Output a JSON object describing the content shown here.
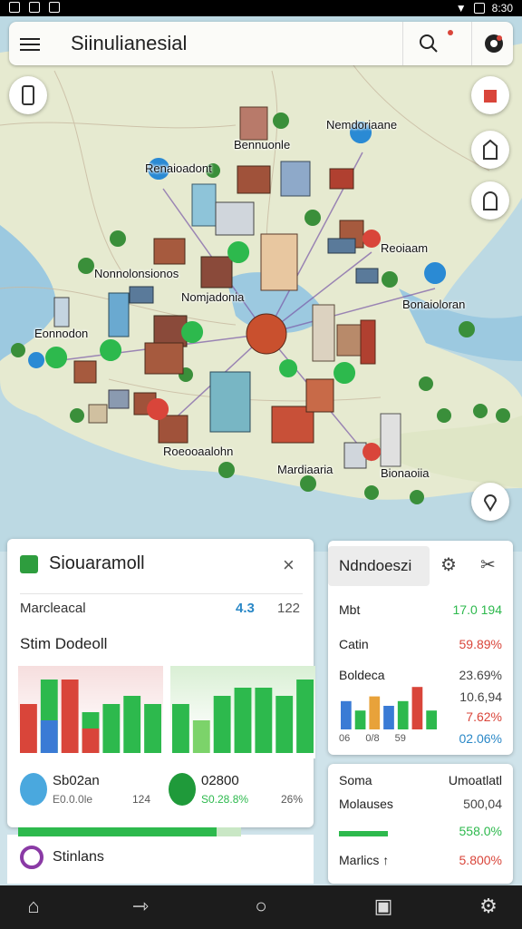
{
  "app": {
    "title": "Siinulianesial"
  },
  "status_bar": {
    "time": "8:30"
  },
  "map": {
    "labels": [
      "Nemdoriaane",
      "Bennuonle",
      "Renaioadont",
      "Nonnolonsionos",
      "Nomjadonia",
      "Eonnodon",
      "Reoiaam",
      "Bonaioloran",
      "Roeooaalohn",
      "Mardiaaria",
      "Bionaoiia"
    ]
  },
  "left_panel": {
    "title": "Siouaramoll",
    "row_label": "Marcleacal",
    "row_value1": "4.3",
    "row_value2": "122",
    "subtitle": "Stim Dodeoll",
    "stat1": {
      "name": "Sb02an",
      "sub": "E0.0.0le",
      "num": "124"
    },
    "stat2": {
      "name": "02800",
      "sub": "S0.28.8%",
      "num": "26%"
    },
    "footer_label": "Stinlans",
    "progress": 0.89
  },
  "right_panel_top": {
    "tab_label": "Ndndoeszi",
    "rows": [
      {
        "label": "Mbt",
        "value": "17.0 194",
        "color": "#2db94d"
      },
      {
        "label": "Catin",
        "value": "59.89%",
        "color": "#d9453a"
      },
      {
        "label": "Boldeca",
        "value": "23.69%",
        "color": "#444"
      },
      {
        "label": "",
        "value": "10.6,94",
        "color": "#444"
      },
      {
        "label": "",
        "value": "7.62%",
        "color": "#d9453a"
      }
    ],
    "axis": [
      "06",
      "0/8",
      "59"
    ],
    "bottom_value": "02.06%"
  },
  "right_panel_bottom": {
    "rows": [
      {
        "label": "Soma",
        "value": "Umoatlatl",
        "color": "#222"
      },
      {
        "label": "Molauses",
        "value": "500,04",
        "color": "#444"
      },
      {
        "label": "",
        "value": "558.0%",
        "color": "#2db94d"
      },
      {
        "label": "Marlics",
        "value": "5.800%",
        "color": "#d9453a"
      }
    ]
  },
  "chart_data": [
    {
      "type": "bar",
      "series": [
        {
          "values": [
            6,
            9,
            9,
            5,
            6,
            7,
            6
          ]
        }
      ],
      "colors": [
        "#d9453a",
        "#2db94d",
        "#d9453a",
        "#2db94d",
        "#2db94d",
        "#2db94d",
        "#2db94d"
      ],
      "overlay": [
        {
          "index": 1,
          "value": 4,
          "color": "#3a7bd5"
        },
        {
          "index": 3,
          "value": 3,
          "color": "#d9453a"
        }
      ]
    },
    {
      "type": "bar",
      "series": [
        {
          "values": [
            6,
            4,
            7,
            8,
            8,
            7,
            9
          ]
        }
      ],
      "colors": [
        "#2db94d",
        "#7cd36a",
        "#2db94d",
        "#2db94d",
        "#2db94d",
        "#2db94d",
        "#2db94d"
      ]
    },
    {
      "type": "bar",
      "series": [
        {
          "values": [
            3,
            2,
            3.5,
            2.5,
            3,
            4.5,
            2
          ]
        }
      ],
      "colors": [
        "#3a7bd5",
        "#2db94d",
        "#e8a23a",
        "#3a7bd5",
        "#2db94d",
        "#d9453a",
        "#2db94d"
      ]
    }
  ]
}
